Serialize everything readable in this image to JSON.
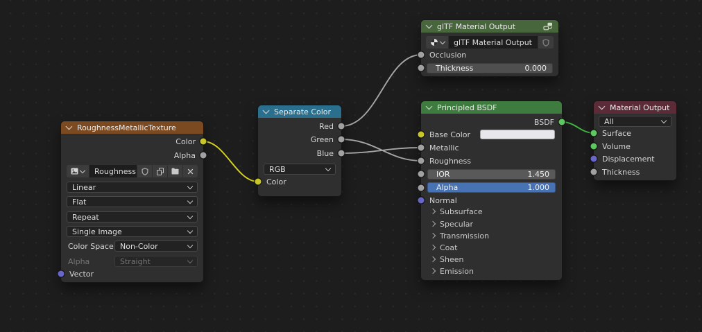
{
  "colors": {
    "background": "#1d1d1d",
    "grid_dot": "#28282a",
    "socket_yellow": "#c7c729",
    "socket_gray": "#a1a1a1",
    "socket_purple": "#6966c9",
    "socket_green": "#5fc75f",
    "wire_yellow": "#d8d522",
    "wire_gray": "#a6a6a6",
    "wire_green": "#42bb42",
    "slider_gray": "#595959",
    "slider_gray_dark": "#4f4f4f",
    "slider_blue": "#4772b3",
    "base_color_swatch": "#e8e8ec"
  },
  "icons": {
    "header_collapse": "chevron-down-icon",
    "section_collapsed": "chevron-right-icon",
    "gltf_header_badge": "node-group-icon",
    "texture_image_button": "image-icon",
    "group_material_button": "material-sphere-icon",
    "image_row_buttons": [
      "shield-icon",
      "duplicate-icon",
      "folder-icon",
      "unlink-x-icon"
    ]
  },
  "nodes": {
    "texture": {
      "title": "RoughnessMetallicTexture",
      "header_color": "#7c4a20",
      "outputs": [
        {
          "label": "Color"
        },
        {
          "label": "Alpha"
        }
      ],
      "image_name": "RoughnessMetal...",
      "interpolation": "Linear",
      "projection": "Flat",
      "extension": "Repeat",
      "source": "Single Image",
      "color_space_label": "Color Space",
      "color_space_value": "Non-Color",
      "alpha_mode_label": "Alpha",
      "alpha_mode_value": "Straight",
      "input_vector": "Vector"
    },
    "separate_color": {
      "title": "Separate Color",
      "header_color": "#2b6f8e",
      "outputs": [
        {
          "label": "Red"
        },
        {
          "label": "Green"
        },
        {
          "label": "Blue"
        }
      ],
      "mode": "RGB",
      "input_color": "Color"
    },
    "gltf_output": {
      "title": "glTF Material Output",
      "header_color": "#48663b",
      "group_name": "glTF Material Output",
      "input_occlusion": "Occlusion",
      "thickness_label": "Thickness",
      "thickness_value": "0.000"
    },
    "principled": {
      "title": "Principled BSDF",
      "header_color": "#3e7b3e",
      "output_label": "BSDF",
      "input_base_color": "Base Color",
      "input_metallic": "Metallic",
      "input_roughness": "Roughness",
      "ior_label": "IOR",
      "ior_value": "1.450",
      "alpha_label": "Alpha",
      "alpha_value": "1.000",
      "input_normal": "Normal",
      "sections": [
        "Subsurface",
        "Specular",
        "Transmission",
        "Coat",
        "Sheen",
        "Emission"
      ]
    },
    "material_output": {
      "title": "Material Output",
      "header_color": "#5c2b38",
      "target": "All",
      "inputs": [
        "Surface",
        "Volume",
        "Displacement",
        "Thickness"
      ]
    }
  }
}
